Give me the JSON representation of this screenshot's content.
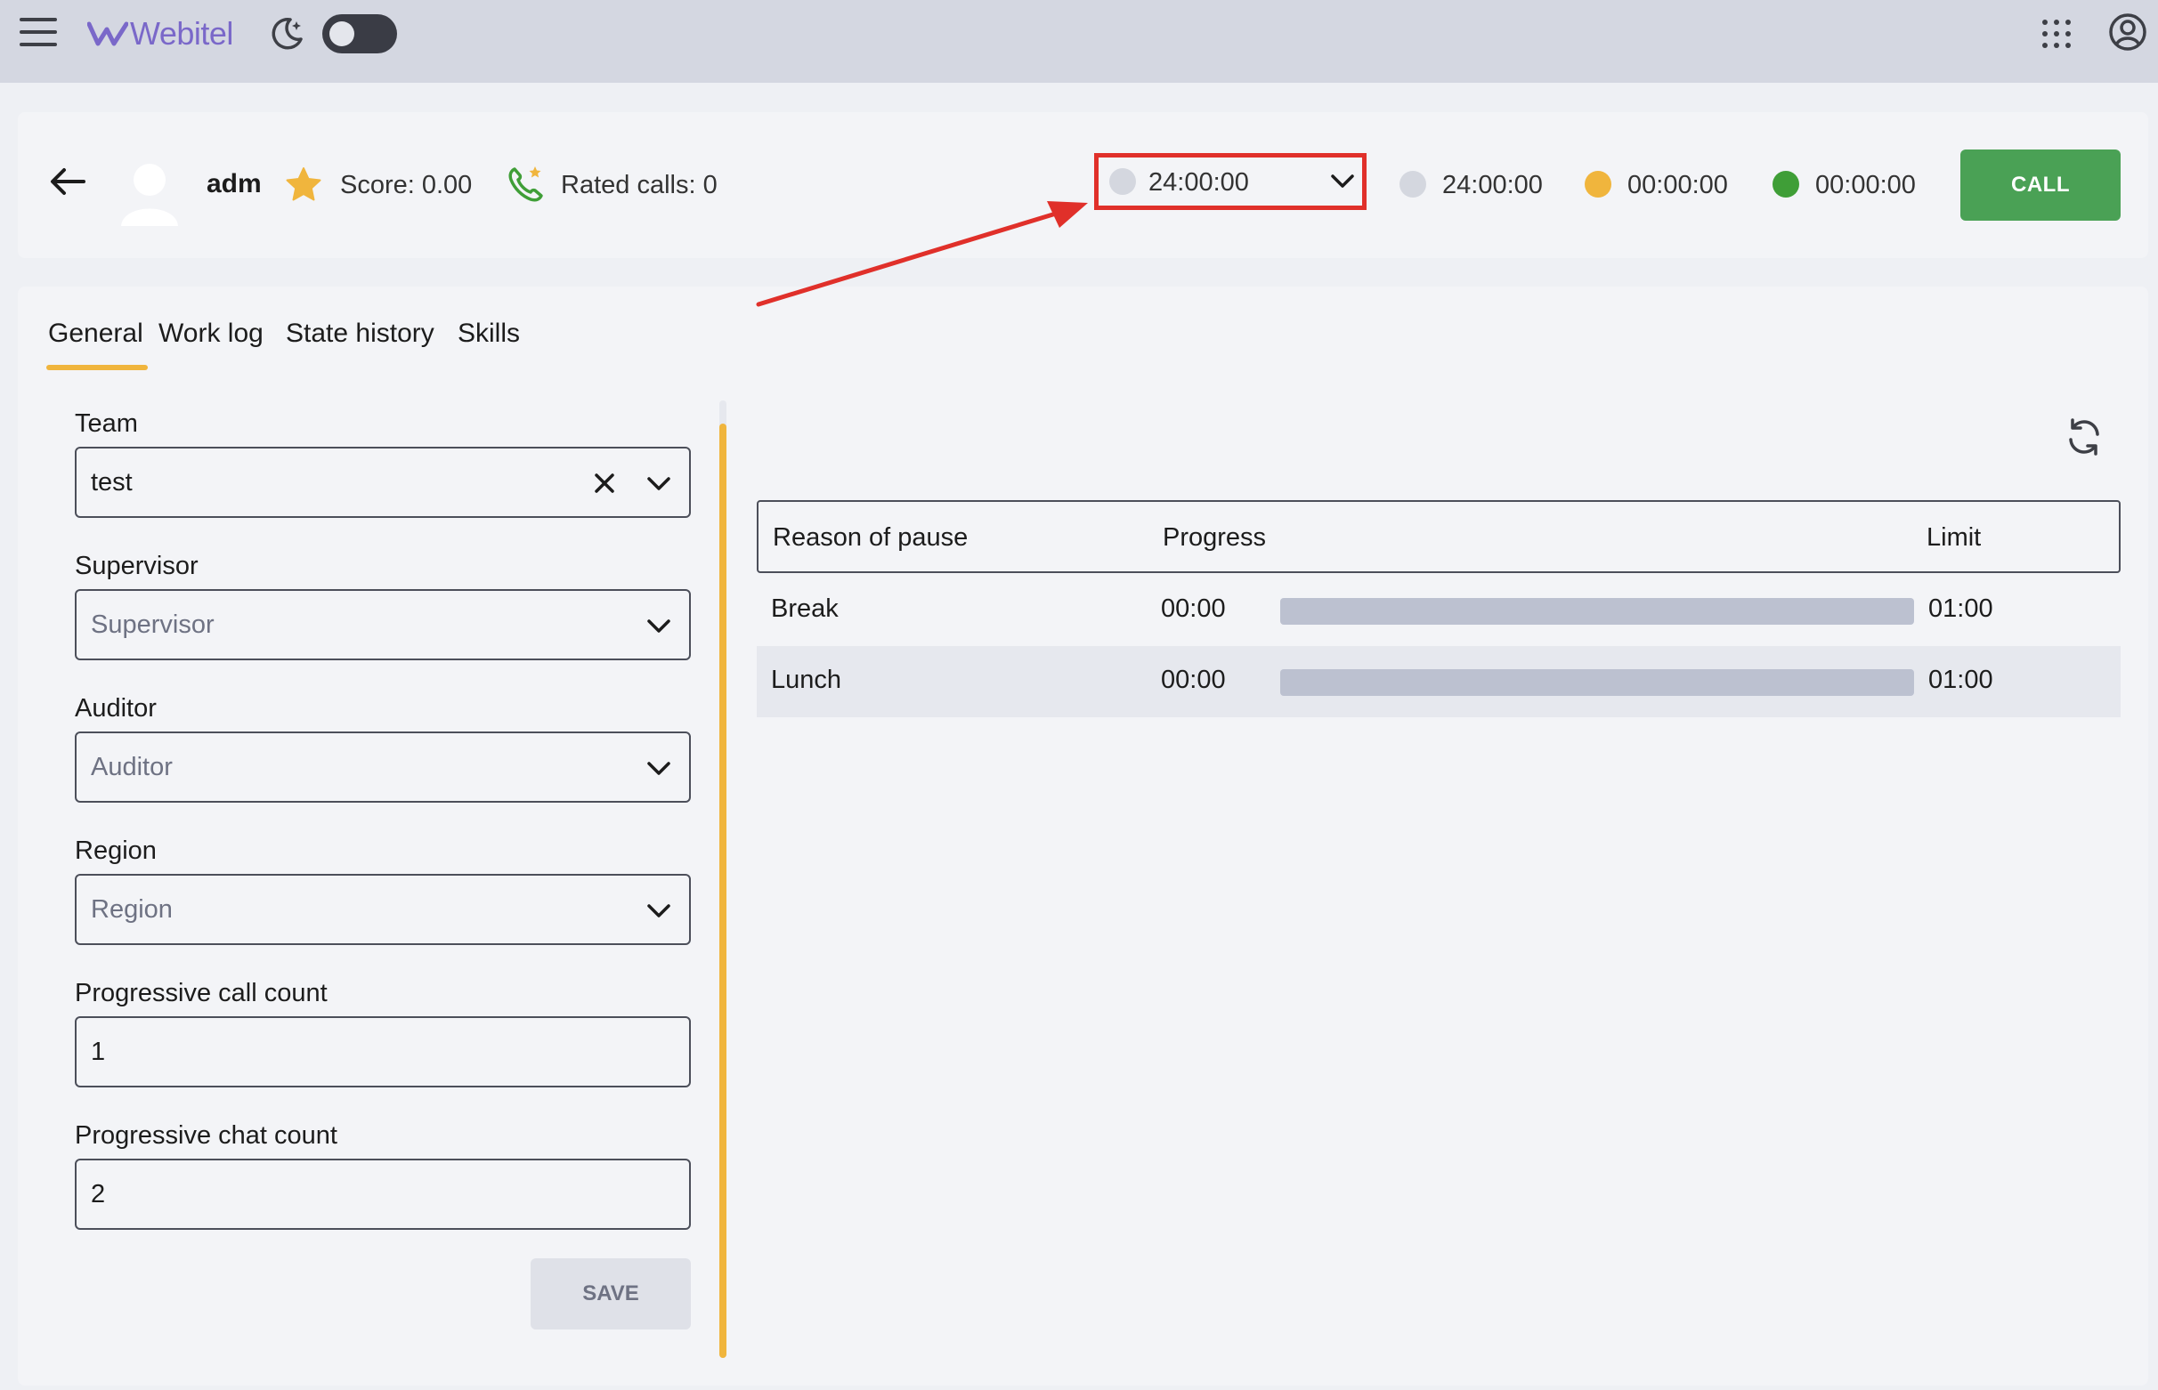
{
  "topbar": {
    "brand": "Webitel",
    "icons": [
      "menu-icon",
      "logo-icon",
      "moon-icon",
      "apps-grid-icon",
      "account-icon"
    ],
    "dark_mode_on": false
  },
  "agent": {
    "name": "adm",
    "score_label": "Score: 0.00",
    "rated_calls_label": "Rated calls: 0"
  },
  "status": {
    "selected_time": "24:00:00",
    "stats": [
      {
        "time": "24:00:00",
        "color": "#d4d7df"
      },
      {
        "time": "00:00:00",
        "color": "#f0b53d"
      },
      {
        "time": "00:00:00",
        "color": "#3f9e37"
      }
    ]
  },
  "call_button": "CALL",
  "tabs": [
    "General",
    "Work log",
    "State history",
    "Skills"
  ],
  "active_tab": "General",
  "form": {
    "team": {
      "label": "Team",
      "value": "test"
    },
    "supervisor": {
      "label": "Supervisor",
      "placeholder": "Supervisor"
    },
    "auditor": {
      "label": "Auditor",
      "placeholder": "Auditor"
    },
    "region": {
      "label": "Region",
      "placeholder": "Region"
    },
    "progressive_call_count": {
      "label": "Progressive call count",
      "value": "1"
    },
    "progressive_chat_count": {
      "label": "Progressive chat count",
      "value": "2"
    },
    "save_label": "SAVE"
  },
  "pause_table": {
    "headers": [
      "Reason of pause",
      "Progress",
      "Limit"
    ],
    "rows": [
      {
        "reason": "Break",
        "progress": "00:00",
        "limit": "01:00",
        "fraction": 0
      },
      {
        "reason": "Lunch",
        "progress": "00:00",
        "limit": "01:00",
        "fraction": 0
      }
    ]
  },
  "colors": {
    "accent": "#f0b53d",
    "call": "#4aa155",
    "highlight": "#e0302a"
  }
}
